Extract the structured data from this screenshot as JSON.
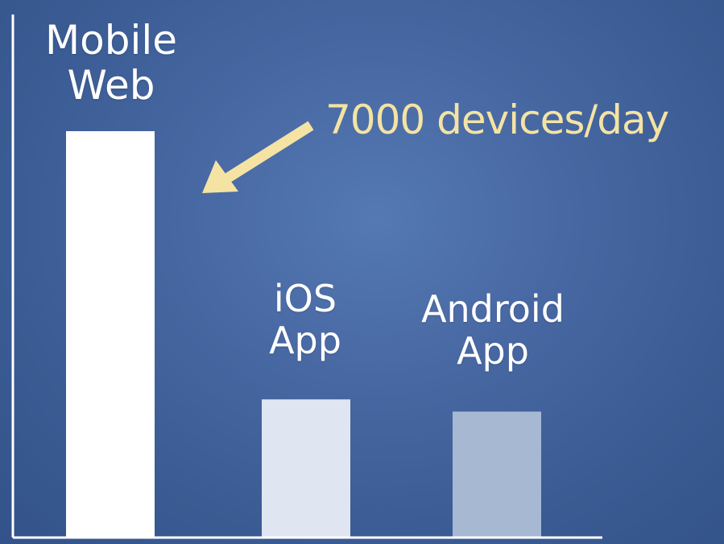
{
  "chart_data": {
    "type": "bar",
    "categories": [
      [
        "Mobile",
        "Web"
      ],
      [
        "iOS",
        "App"
      ],
      [
        "Android",
        "App"
      ]
    ],
    "values": [
      100,
      34,
      31
    ],
    "ylim": [
      0,
      100
    ],
    "title": "",
    "xlabel": "",
    "ylabel": "",
    "grid": false,
    "annotation": {
      "text": "7000 devices/day",
      "target_category": 0
    },
    "colors": {
      "bars": [
        "#ffffff",
        "#dfe6f1",
        "#a7b8d3"
      ],
      "annotation": "#f4e3a2",
      "axis": "#ffffff",
      "background": "#3d5f96"
    }
  }
}
